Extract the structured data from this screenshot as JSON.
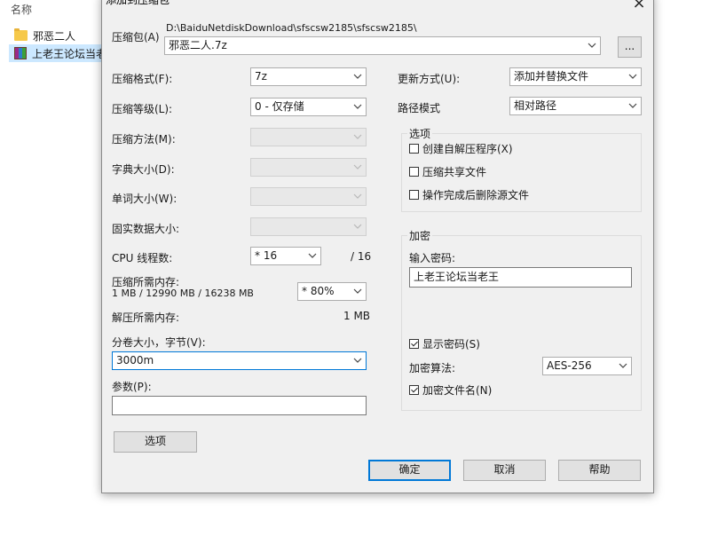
{
  "explorer": {
    "column_header": "名称",
    "items": [
      {
        "name": "邪恶二人",
        "icon": "folder-icon"
      },
      {
        "name": "上老王论坛当老",
        "icon": "rar-archive-icon"
      }
    ]
  },
  "dialog": {
    "title": "添加到压缩包",
    "close_glyph": "×",
    "archive": {
      "label": "压缩包(A)",
      "path": "D:\\BaiduNetdiskDownload\\sfscsw2185\\sfscsw2185\\",
      "value": "邪恶二人.7z",
      "browse_label": "..."
    },
    "left": {
      "format": {
        "label": "压缩格式(F):",
        "value": "7z"
      },
      "level": {
        "label": "压缩等级(L):",
        "value": "0 - 仅存储"
      },
      "method": {
        "label": "压缩方法(M):",
        "value": ""
      },
      "dict": {
        "label": "字典大小(D):",
        "value": ""
      },
      "word": {
        "label": "单词大小(W):",
        "value": ""
      },
      "solid": {
        "label": "固实数据大小:",
        "value": ""
      },
      "threads": {
        "label": "CPU 线程数:",
        "value": "* 16",
        "max": "/ 16"
      },
      "mem_compress": {
        "label": "压缩所需内存:",
        "detail": "1 MB / 12990 MB / 16238 MB",
        "value": "* 80%"
      },
      "mem_decompress": {
        "label": "解压所需内存:",
        "value": "1 MB"
      },
      "volume": {
        "label": "分卷大小，字节(V):",
        "value": "3000m"
      },
      "params": {
        "label": "参数(P):",
        "value": ""
      },
      "options_button": "选项"
    },
    "right": {
      "update": {
        "label": "更新方式(U):",
        "value": "添加并替换文件"
      },
      "pathmode": {
        "label": "路径模式",
        "value": "相对路径"
      },
      "options_group": {
        "title": "选项",
        "sfx": {
          "label": "创建自解压程序(X)",
          "checked": false
        },
        "shared": {
          "label": "压缩共享文件",
          "checked": false
        },
        "delete": {
          "label": "操作完成后删除源文件",
          "checked": false
        }
      },
      "encryption": {
        "title": "加密",
        "password_label": "输入密码:",
        "password_value": "上老王论坛当老王",
        "show_password": {
          "label": "显示密码(S)",
          "checked": true
        },
        "method_label": "加密算法:",
        "method_value": "AES-256",
        "encrypt_names": {
          "label": "加密文件名(N)",
          "checked": true
        }
      }
    },
    "buttons": {
      "ok": "确定",
      "cancel": "取消",
      "help": "帮助"
    }
  }
}
